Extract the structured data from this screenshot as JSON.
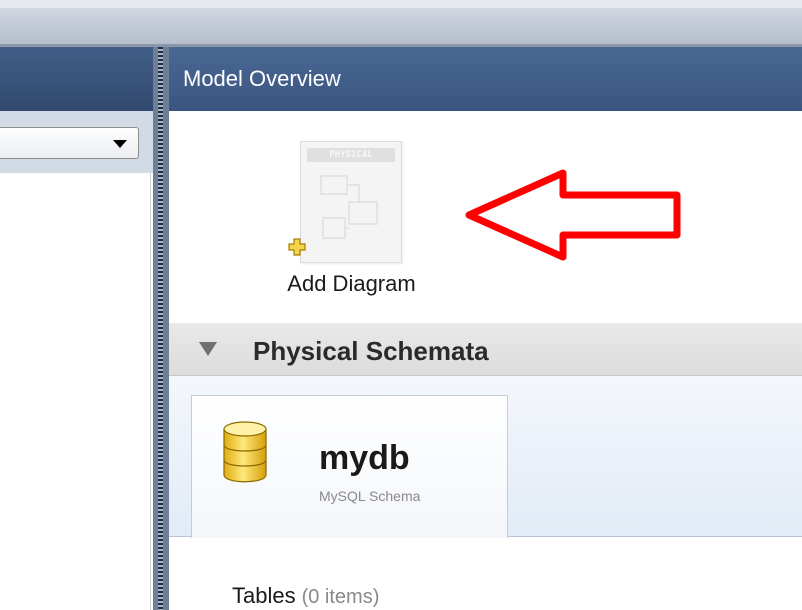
{
  "main": {
    "header_title": "Model Overview",
    "add_diagram": {
      "label": "Add Diagram",
      "thumbnail_text": "PHYSICAL"
    },
    "physical_schemata": {
      "title": "Physical Schemata",
      "schema": {
        "name": "mydb",
        "type": "MySQL Schema"
      }
    },
    "tables": {
      "label": "Tables",
      "count": "(0 items)"
    }
  },
  "annotation": {
    "arrow_color": "#ff0000"
  },
  "icons": {
    "dropdown": "chevron-down-icon",
    "section_toggle": "triangle-down-icon",
    "schema": "database-icon",
    "add": "plus-icon"
  },
  "colors": {
    "header": "#3a5580",
    "arrow": "#ff0000",
    "schema_icon": "#f2c51c"
  }
}
